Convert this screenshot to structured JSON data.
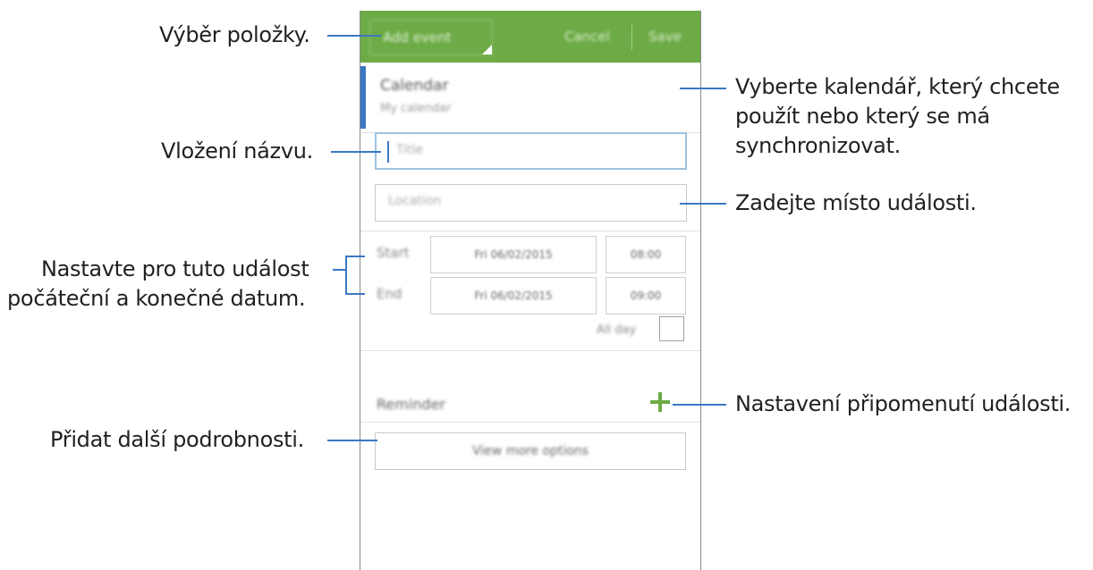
{
  "actionbar": {
    "dropdown_label": "Add event",
    "cancel_label": "Cancel",
    "save_label": "Save"
  },
  "calendar": {
    "title": "Calendar",
    "account": "My calendar"
  },
  "form": {
    "title_placeholder": "Title",
    "location_placeholder": "Location",
    "start_label": "Start",
    "end_label": "End",
    "start_date": "Fri 06/02/2015",
    "start_time": "08:00",
    "end_date": "Fri 06/02/2015",
    "end_time": "09:00",
    "all_day_label": "All day",
    "reminder_label": "Reminder",
    "more_options_label": "View more options"
  },
  "callouts": {
    "select_item": "Výběr položky.",
    "calendar_line1": "Vyberte kalendář, který chcete",
    "calendar_line2": "použít nebo který se má",
    "calendar_line3": "synchronizovat.",
    "enter_title": "Vložení názvu.",
    "enter_location": "Zadejte místo události.",
    "dates_line1": "Nastavte pro tuto událost",
    "dates_line2": "počáteční a konečné datum.",
    "reminder": "Nastavení připomenutí události.",
    "more_details": "Přidat další podrobnosti."
  },
  "colors": {
    "actionbar": "#6cab45",
    "accent_blue": "#3a78c4",
    "plus_green": "#6cab45"
  },
  "icons": {
    "dropdown_indicator": "dropdown-triangle-icon",
    "add_reminder": "plus-icon"
  }
}
